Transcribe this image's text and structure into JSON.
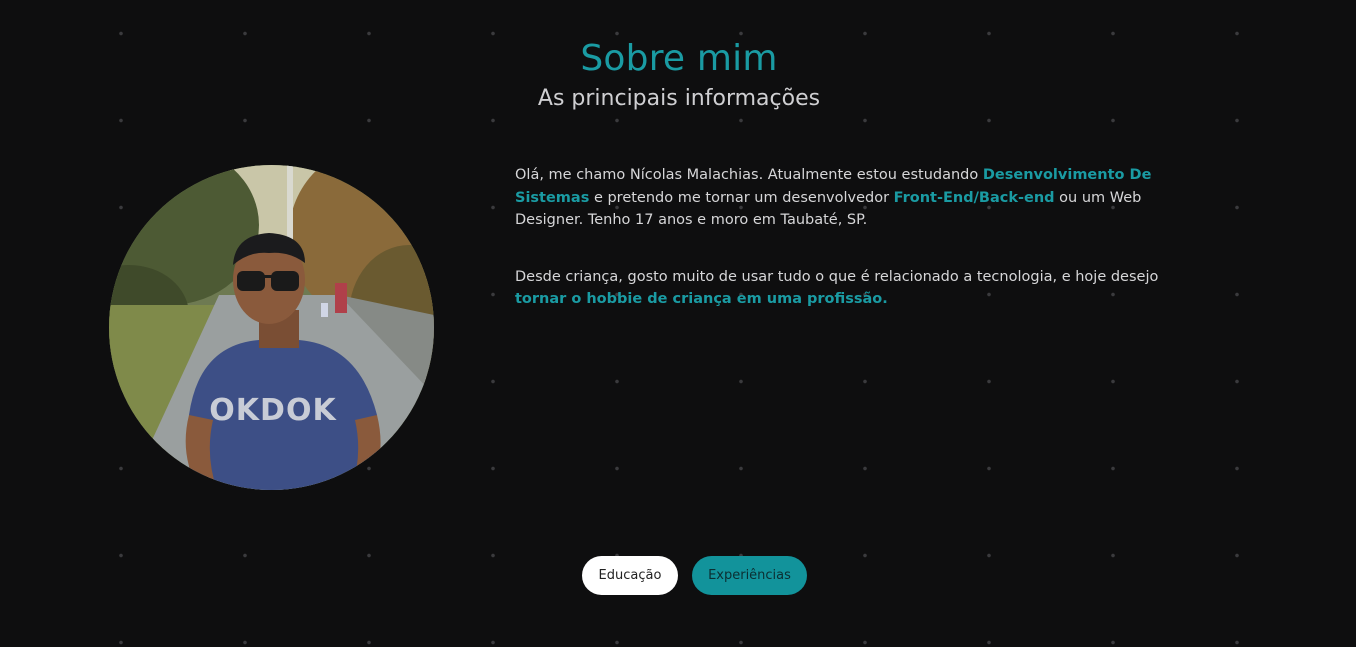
{
  "section": {
    "title": "Sobre mim",
    "subtitle": "As principais informações"
  },
  "bio": {
    "p1_a": "Olá, me chamo Nícolas Malachias. Atualmente estou estudando ",
    "p1_hl1": "Desenvolvimento De Sistemas",
    "p1_b": " e pretendo me tornar um desenvolvedor ",
    "p1_hl2": "Front-End/Back-end",
    "p1_c": " ou um Web Designer. Tenho 17 anos e moro em Taubaté, SP.",
    "p2_a": "Desde criança, gosto muito de usar tudo o que é relacionado a tecnologia, e hoje desejo ",
    "p2_hl": "tornar o hobbie de criança em uma profissão."
  },
  "photo": {
    "shirt_text": "OKDOK"
  },
  "buttons": {
    "education": "Educação",
    "experience": "Experiências"
  },
  "colors": {
    "background": "#0e0e0f",
    "accent": "#1a9ba3",
    "text": "#d6d6d8"
  }
}
